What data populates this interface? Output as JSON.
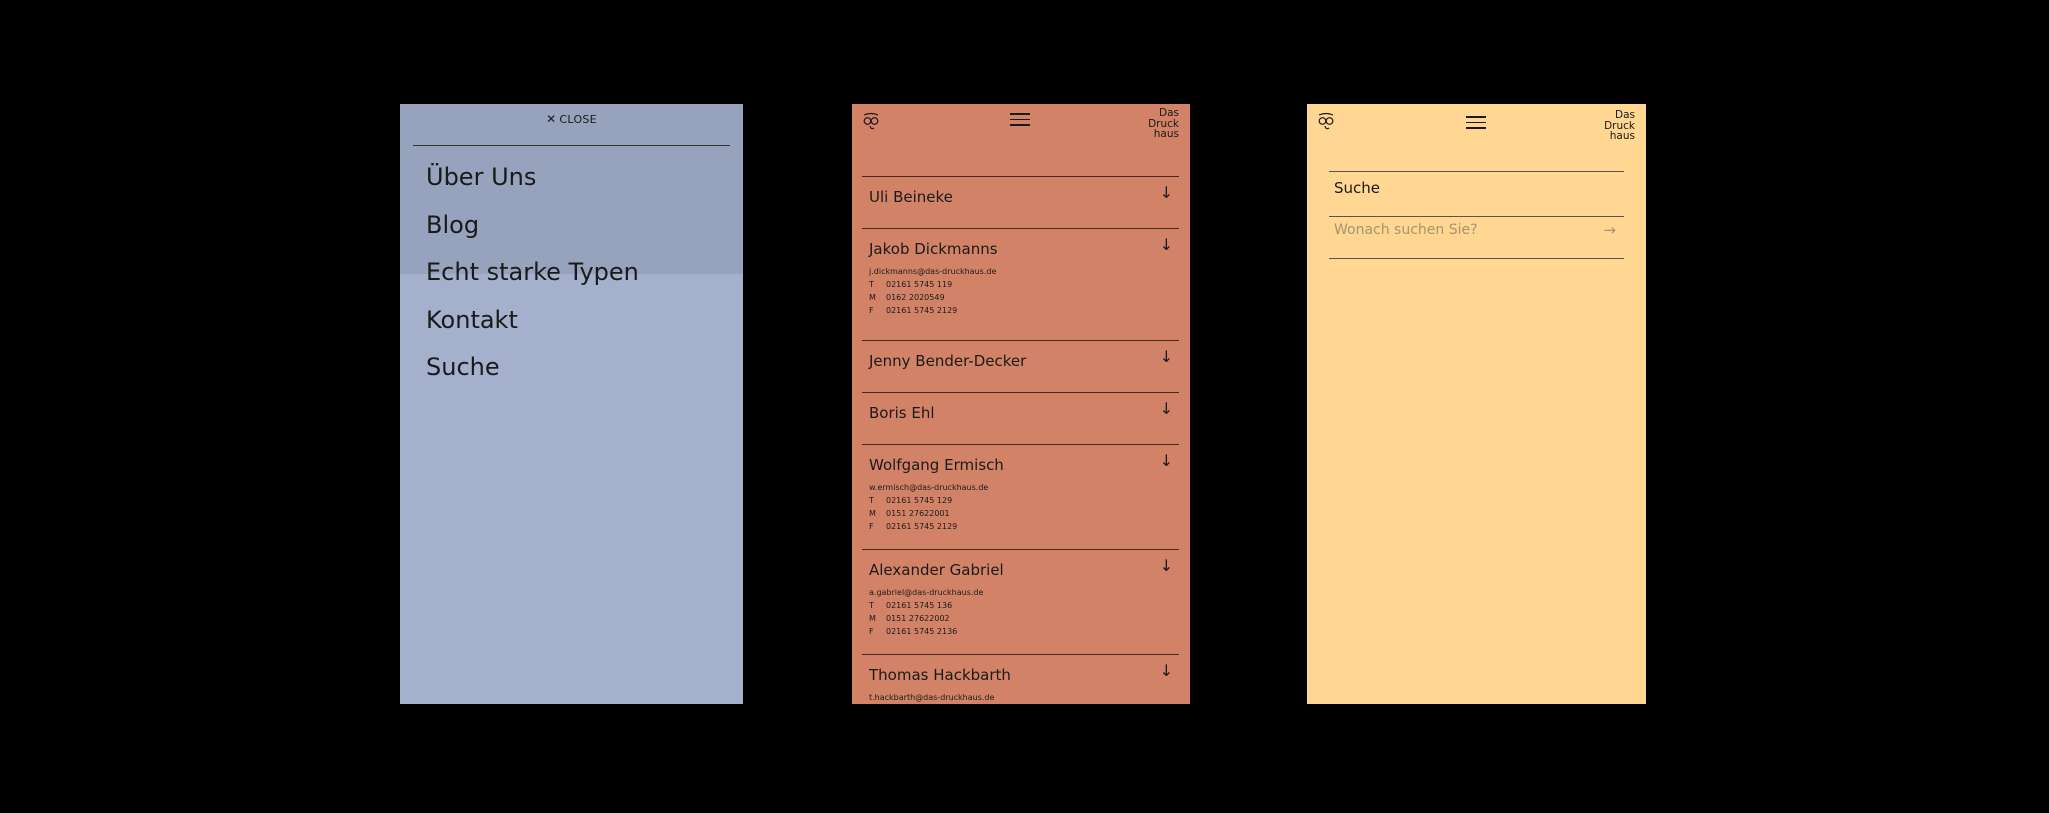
{
  "menu_screen": {
    "close_label": "CLOSE",
    "items": [
      {
        "label": "Über Uns"
      },
      {
        "label": "Blog"
      },
      {
        "label": "Echt starke Typen"
      },
      {
        "label": "Kontakt"
      },
      {
        "label": "Suche"
      }
    ]
  },
  "brand": {
    "wordmark_line1": "Das",
    "wordmark_line2": "Druck",
    "wordmark_line3": "haus"
  },
  "team_screen": {
    "people": [
      {
        "name": "Uli Beineke"
      },
      {
        "name": "Jakob Dickmanns",
        "email": "j.dickmanns@das-druckhaus.de",
        "t": "02161 5745 119",
        "m": "0162 2020549",
        "f": "02161 5745 2129"
      },
      {
        "name": "Jenny Bender-Decker"
      },
      {
        "name": "Boris Ehl"
      },
      {
        "name": "Wolfgang Ermisch",
        "email": "w.ermisch@das-druckhaus.de",
        "t": "02161 5745 129",
        "m": "0151 27622001",
        "f": "02161 5745 2129"
      },
      {
        "name": "Alexander Gabriel",
        "email": "a.gabriel@das-druckhaus.de",
        "t": "02161 5745 136",
        "m": "0151 27622002",
        "f": "02161 5745 2136"
      },
      {
        "name": "Thomas Hackbarth",
        "email": "t.hackbarth@das-druckhaus.de"
      }
    ],
    "label_t": "T",
    "label_m": "M",
    "label_f": "F"
  },
  "search_screen": {
    "title": "Suche",
    "placeholder": "Wonach suchen Sie?"
  },
  "colors": {
    "menu_bg": "#a4b0cc",
    "team_bg": "#d28367",
    "search_bg": "#ffd792"
  }
}
